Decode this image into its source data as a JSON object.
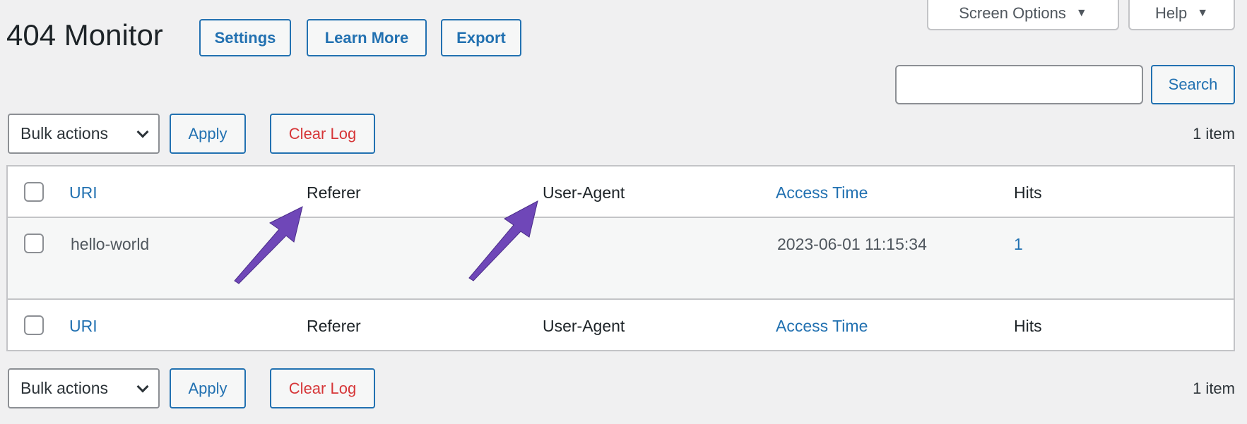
{
  "page": {
    "title": "404 Monitor"
  },
  "header_buttons": {
    "settings": "Settings",
    "learn_more": "Learn More",
    "export": "Export"
  },
  "screen_tabs": {
    "screen_options": "Screen Options",
    "help": "Help",
    "arrow_icon": "triangle-down-icon"
  },
  "search": {
    "value": "",
    "placeholder": "",
    "button": "Search"
  },
  "top_nav": {
    "bulk_actions": "Bulk actions",
    "apply": "Apply",
    "clear_log": "Clear Log",
    "count": "1 item"
  },
  "bottom_nav": {
    "bulk_actions": "Bulk actions",
    "apply": "Apply",
    "clear_log": "Clear Log",
    "count": "1 item"
  },
  "table": {
    "columns": [
      "URI",
      "Referer",
      "User-Agent",
      "Access Time",
      "Hits"
    ],
    "rows": [
      {
        "uri": "hello-world",
        "referer": "",
        "user_agent": "",
        "access_time": "2023-06-01 11:15:34",
        "hits": "1"
      }
    ]
  },
  "colors": {
    "accent": "#2271b1",
    "danger": "#d63638",
    "annotation_arrow": "#6f47b8"
  }
}
